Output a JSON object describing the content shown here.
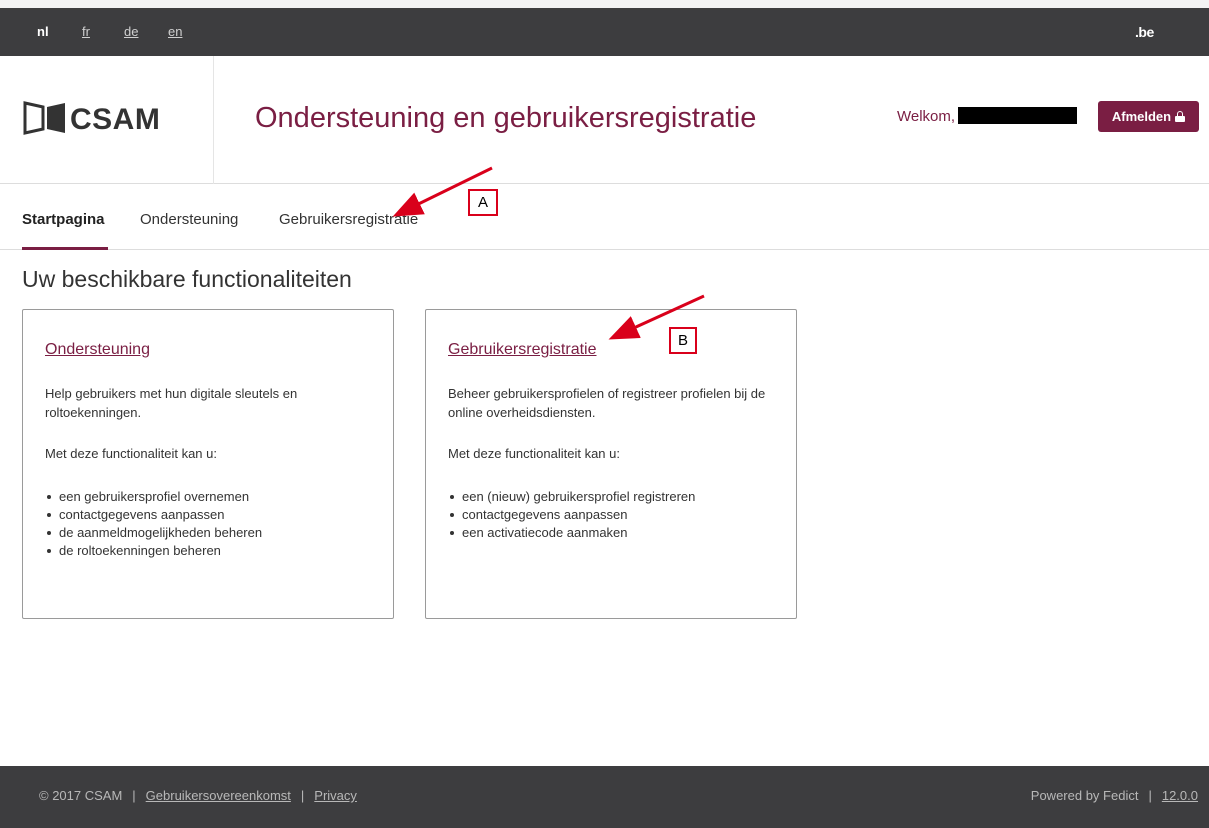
{
  "languages": [
    {
      "code": "nl",
      "active": true
    },
    {
      "code": "fr",
      "active": false
    },
    {
      "code": "de",
      "active": false
    },
    {
      "code": "en",
      "active": false
    }
  ],
  "top_right_logo": ".be",
  "header": {
    "logo_text": "CSAM",
    "title": "Ondersteuning en gebruikersregistratie",
    "welcome": "Welkom,",
    "logout_label": "Afmelden"
  },
  "nav": {
    "items": [
      "Startpagina",
      "Ondersteuning",
      "Gebruikersregistratie"
    ],
    "active_index": 0
  },
  "section_title": "Uw beschikbare functionaliteiten",
  "cards": [
    {
      "title": "Ondersteuning",
      "description": "Help gebruikers met hun digitale sleutels en roltoekenningen.",
      "subtitle": "Met deze functionaliteit kan u:",
      "items": [
        "een gebruikersprofiel overnemen",
        "contactgegevens aanpassen",
        "de aanmeldmogelijkheden beheren",
        "de roltoekenningen beheren"
      ]
    },
    {
      "title": "Gebruikersregistratie",
      "description": "Beheer gebruikersprofielen of registreer profielen bij de online overheidsdiensten.",
      "subtitle": "Met deze functionaliteit kan u:",
      "items": [
        "een (nieuw) gebruikersprofiel registreren",
        "contactgegevens aanpassen",
        "een activatiecode aanmaken"
      ]
    }
  ],
  "annotations": {
    "a": "A",
    "b": "B"
  },
  "footer": {
    "copyright": "© 2017 CSAM",
    "link_agreement": "Gebruikersovereenkomst",
    "link_privacy": "Privacy",
    "powered_by": "Powered by Fedict",
    "version": "12.0.0",
    "separator": "|"
  },
  "colors": {
    "brand": "#7a1e43",
    "dark_bar": "#3d3d3f",
    "annotation": "#d9001b"
  }
}
